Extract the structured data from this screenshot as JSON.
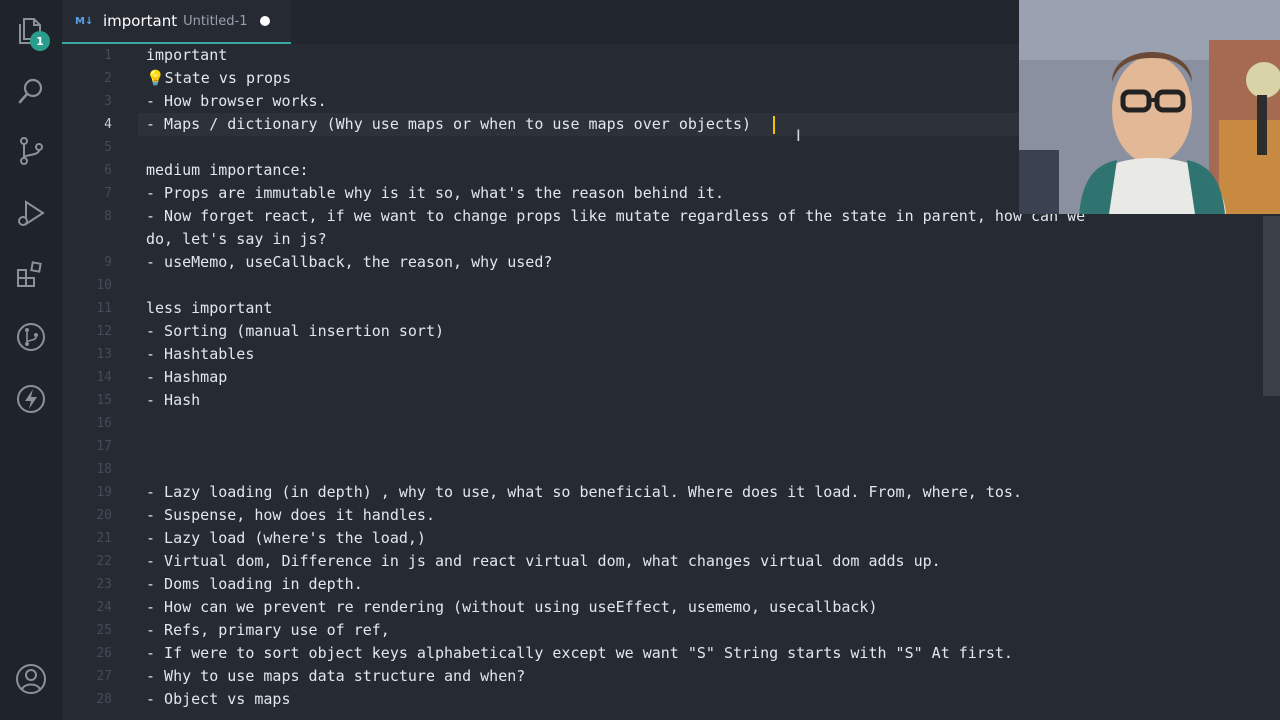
{
  "activity_bar": {
    "explorer_badge": "1",
    "icons": [
      "files-icon",
      "search-icon",
      "source-control-icon",
      "run-debug-icon",
      "extensions-icon",
      "git-graph-icon",
      "lightning-icon",
      "account-icon"
    ]
  },
  "tab": {
    "md_badge": "M↓",
    "name": "important",
    "description": "Untitled-1"
  },
  "editor": {
    "current_line": 4,
    "lines": [
      {
        "n": "1",
        "text": "important"
      },
      {
        "n": "2",
        "text": "💡State vs props"
      },
      {
        "n": "3",
        "text": "- How browser works."
      },
      {
        "n": "4",
        "text": "- Maps / dictionary (Why use maps or when to use maps over objects)"
      },
      {
        "n": "5",
        "text": ""
      },
      {
        "n": "6",
        "text": "medium importance:"
      },
      {
        "n": "7",
        "text": "- Props are immutable why is it so, what's the reason behind it."
      },
      {
        "n": "8",
        "text": "- Now forget react, if we want to change props like mutate regardless of the state in parent, how can we"
      },
      {
        "n": "",
        "text": "do, let's say in js?"
      },
      {
        "n": "9",
        "text": "- useMemo, useCallback, the reason, why used?"
      },
      {
        "n": "10",
        "text": ""
      },
      {
        "n": "11",
        "text": "less important"
      },
      {
        "n": "12",
        "text": "- Sorting (manual insertion sort)"
      },
      {
        "n": "13",
        "text": "- Hashtables"
      },
      {
        "n": "14",
        "text": "- Hashmap"
      },
      {
        "n": "15",
        "text": "- Hash"
      },
      {
        "n": "16",
        "text": ""
      },
      {
        "n": "17",
        "text": ""
      },
      {
        "n": "18",
        "text": ""
      },
      {
        "n": "19",
        "text": "- Lazy loading (in depth) , why to use, what so beneficial. Where does it load. From, where, tos."
      },
      {
        "n": "20",
        "text": "- Suspense, how does it handles."
      },
      {
        "n": "21",
        "text": "- Lazy load (where's the load,)"
      },
      {
        "n": "22",
        "text": "- Virtual dom, Difference in js and react virtual dom, what changes virtual dom adds up."
      },
      {
        "n": "23",
        "text": "- Doms loading in depth."
      },
      {
        "n": "24",
        "text": "- How can we prevent re rendering (without using useEffect, usememo, usecallback)"
      },
      {
        "n": "25",
        "text": "- Refs, primary use of ref,"
      },
      {
        "n": "26",
        "text": "- If were to sort object keys alphabetically except we want \"S\" String starts with \"S\" At first."
      },
      {
        "n": "27",
        "text": "- Why to use maps data structure and when?"
      },
      {
        "n": "28",
        "text": "- Object vs maps"
      }
    ]
  },
  "colors": {
    "editor_bg": "#262b33",
    "activity_bg": "#1f232a",
    "tab_accent": "#3aa7a0",
    "cursor": "#f0c400",
    "badge": "#2a9d8f"
  }
}
